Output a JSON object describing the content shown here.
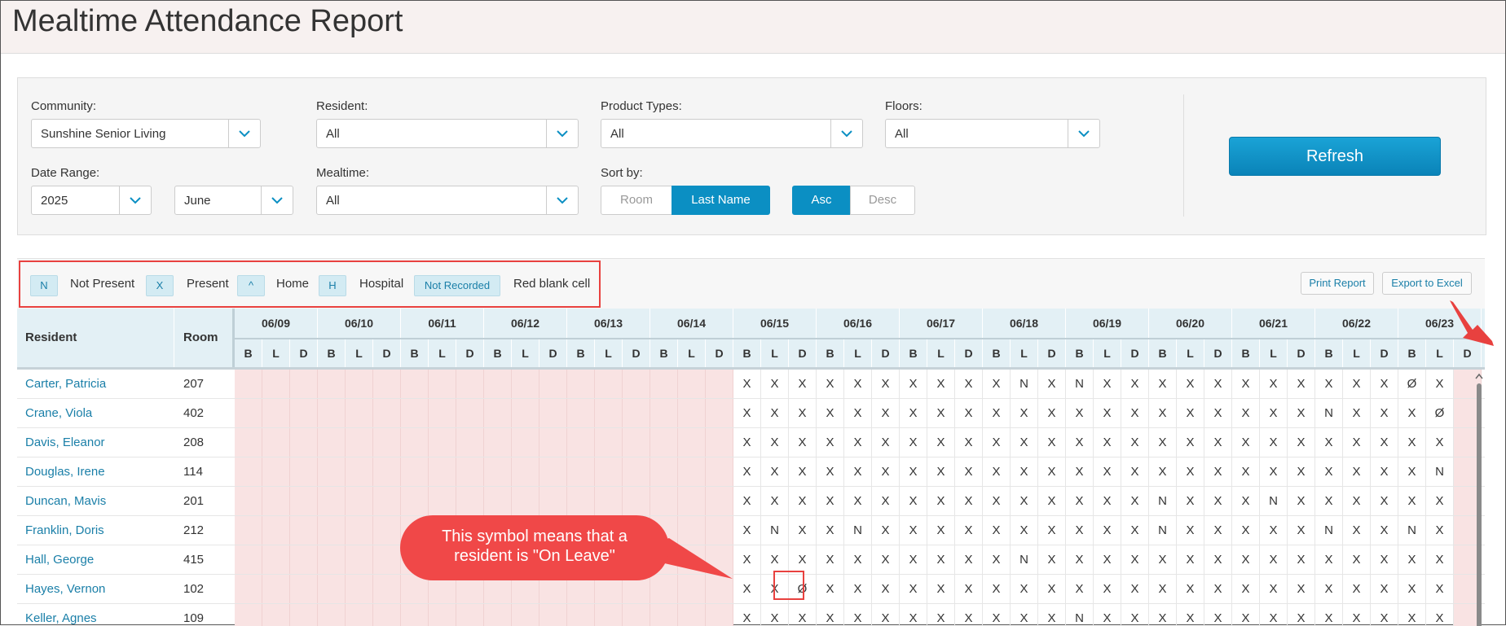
{
  "page": {
    "title": "Mealtime Attendance Report"
  },
  "filters": {
    "community": {
      "label": "Community:",
      "value": "Sunshine Senior Living"
    },
    "resident": {
      "label": "Resident:",
      "value": "All"
    },
    "product_types": {
      "label": "Product Types:",
      "value": "All"
    },
    "floors": {
      "label": "Floors:",
      "value": "All"
    },
    "date_range": {
      "label": "Date Range:",
      "year": "2025",
      "month": "June"
    },
    "mealtime": {
      "label": "Mealtime:",
      "value": "All"
    },
    "sort_by": {
      "label": "Sort by:",
      "options": [
        "Room",
        "Last Name"
      ],
      "selected": "Last Name",
      "order_options": [
        "Asc",
        "Desc"
      ],
      "order_selected": "Asc"
    },
    "refresh_label": "Refresh"
  },
  "legend": [
    {
      "code": "N",
      "label": "Not Present"
    },
    {
      "code": "X",
      "label": "Present"
    },
    {
      "code": "^",
      "label": "Home"
    },
    {
      "code": "H",
      "label": "Hospital"
    },
    {
      "code": "Not Recorded",
      "label": "Red blank cell"
    }
  ],
  "actions": {
    "print_label": "Print Report",
    "export_label": "Export to Excel"
  },
  "table": {
    "col_resident": "Resident",
    "col_room": "Room",
    "dates": [
      "06/09",
      "06/10",
      "06/11",
      "06/12",
      "06/13",
      "06/14",
      "06/15",
      "06/16",
      "06/17",
      "06/18",
      "06/19",
      "06/20",
      "06/21",
      "06/22",
      "06/23"
    ],
    "meals": [
      "B",
      "L",
      "D"
    ],
    "rows": [
      {
        "name": "Carter, Patricia",
        "room": "207",
        "cells": [
          "",
          "",
          "",
          "",
          "",
          "",
          "",
          "",
          "",
          "",
          "",
          "",
          "",
          "",
          "",
          "",
          "",
          "",
          "X",
          "X",
          "X",
          "X",
          "X",
          "X",
          "X",
          "X",
          "X",
          "X",
          "N",
          "X",
          "N",
          "X",
          "X",
          "X",
          "X",
          "X",
          "X",
          "X",
          "X",
          "X",
          "X",
          "X",
          "Ø",
          "X",
          ""
        ]
      },
      {
        "name": "Crane, Viola",
        "room": "402",
        "cells": [
          "",
          "",
          "",
          "",
          "",
          "",
          "",
          "",
          "",
          "",
          "",
          "",
          "",
          "",
          "",
          "",
          "",
          "",
          "X",
          "X",
          "X",
          "X",
          "X",
          "X",
          "X",
          "X",
          "X",
          "X",
          "X",
          "X",
          "X",
          "X",
          "X",
          "X",
          "X",
          "X",
          "X",
          "X",
          "X",
          "N",
          "X",
          "X",
          "X",
          "Ø",
          ""
        ]
      },
      {
        "name": "Davis, Eleanor",
        "room": "208",
        "cells": [
          "",
          "",
          "",
          "",
          "",
          "",
          "",
          "",
          "",
          "",
          "",
          "",
          "",
          "",
          "",
          "",
          "",
          "",
          "X",
          "X",
          "X",
          "X",
          "X",
          "X",
          "X",
          "X",
          "X",
          "X",
          "X",
          "X",
          "X",
          "X",
          "X",
          "X",
          "X",
          "X",
          "X",
          "X",
          "X",
          "X",
          "X",
          "X",
          "X",
          "X",
          ""
        ]
      },
      {
        "name": "Douglas, Irene",
        "room": "114",
        "cells": [
          "",
          "",
          "",
          "",
          "",
          "",
          "",
          "",
          "",
          "",
          "",
          "",
          "",
          "",
          "",
          "",
          "",
          "",
          "X",
          "X",
          "X",
          "X",
          "X",
          "X",
          "X",
          "X",
          "X",
          "X",
          "X",
          "X",
          "X",
          "X",
          "X",
          "X",
          "X",
          "X",
          "X",
          "X",
          "X",
          "X",
          "X",
          "X",
          "X",
          "N",
          ""
        ]
      },
      {
        "name": "Duncan, Mavis",
        "room": "201",
        "cells": [
          "",
          "",
          "",
          "",
          "",
          "",
          "",
          "",
          "",
          "",
          "",
          "",
          "",
          "",
          "",
          "",
          "",
          "",
          "X",
          "X",
          "X",
          "X",
          "X",
          "X",
          "X",
          "X",
          "X",
          "X",
          "X",
          "X",
          "X",
          "X",
          "X",
          "N",
          "X",
          "X",
          "X",
          "N",
          "X",
          "X",
          "X",
          "X",
          "X",
          "X",
          ""
        ]
      },
      {
        "name": "Franklin, Doris",
        "room": "212",
        "cells": [
          "",
          "",
          "",
          "",
          "",
          "",
          "",
          "",
          "",
          "",
          "",
          "",
          "",
          "",
          "",
          "",
          "",
          "",
          "X",
          "N",
          "X",
          "X",
          "N",
          "X",
          "X",
          "X",
          "X",
          "X",
          "X",
          "X",
          "X",
          "X",
          "X",
          "N",
          "X",
          "X",
          "X",
          "X",
          "X",
          "N",
          "X",
          "X",
          "N",
          "X",
          ""
        ]
      },
      {
        "name": "Hall, George",
        "room": "415",
        "cells": [
          "",
          "",
          "",
          "",
          "",
          "",
          "",
          "",
          "",
          "",
          "",
          "",
          "",
          "",
          "",
          "",
          "",
          "",
          "X",
          "X",
          "X",
          "X",
          "X",
          "X",
          "X",
          "X",
          "X",
          "X",
          "N",
          "X",
          "X",
          "X",
          "X",
          "X",
          "X",
          "X",
          "X",
          "X",
          "X",
          "X",
          "X",
          "X",
          "X",
          "X",
          ""
        ]
      },
      {
        "name": "Hayes, Vernon",
        "room": "102",
        "cells": [
          "",
          "",
          "",
          "",
          "",
          "",
          "",
          "",
          "",
          "",
          "",
          "",
          "",
          "",
          "",
          "",
          "",
          "",
          "X",
          "X",
          "Ø",
          "X",
          "X",
          "X",
          "X",
          "X",
          "X",
          "X",
          "X",
          "X",
          "X",
          "X",
          "X",
          "X",
          "X",
          "X",
          "X",
          "X",
          "X",
          "X",
          "X",
          "X",
          "X",
          "X",
          ""
        ]
      },
      {
        "name": "Keller, Agnes",
        "room": "109",
        "cells": [
          "",
          "",
          "",
          "",
          "",
          "",
          "",
          "",
          "",
          "",
          "",
          "",
          "",
          "",
          "",
          "",
          "",
          "",
          "X",
          "X",
          "X",
          "X",
          "X",
          "X",
          "X",
          "X",
          "X",
          "X",
          "X",
          "X",
          "N",
          "X",
          "X",
          "X",
          "X",
          "X",
          "X",
          "X",
          "X",
          "X",
          "X",
          "X",
          "X",
          "X",
          ""
        ]
      }
    ]
  },
  "callout": {
    "text": "This symbol means that a resident is \"On Leave\""
  },
  "colors": {
    "accent": "#0b8fc3",
    "blank_cell": "#f9e3e3",
    "annotation": "#e8413f"
  }
}
